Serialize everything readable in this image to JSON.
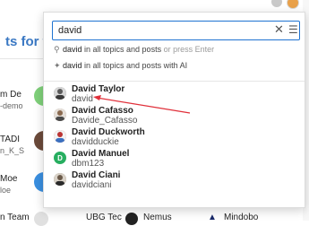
{
  "background": {
    "heading": "ts for te",
    "items": [
      {
        "name": "m De",
        "handle": "-demo"
      },
      {
        "name": "TADI",
        "handle": "n_K_S"
      },
      {
        "name": "Moe",
        "handle": "loe"
      },
      {
        "name": "n Team",
        "handle": ""
      },
      {
        "name": "UBG Tec",
        "handle": ""
      },
      {
        "name": "Nemus",
        "handle": ""
      },
      {
        "name": "Mindobo",
        "handle": ""
      }
    ]
  },
  "search": {
    "value": "david",
    "clear_icon": "✕",
    "options_icon": "☰"
  },
  "suggestions": [
    {
      "icon": "search-icon",
      "term": "david",
      "desc": " in all topics and posts",
      "hint": " or press Enter"
    },
    {
      "icon": "ai-sparkle-icon",
      "term": "david",
      "desc": " in all topics and posts with AI",
      "hint": ""
    }
  ],
  "users": [
    {
      "name": "David Taylor",
      "handle": "david",
      "avatar_color": "#6b6b6b",
      "avatar_letter": ""
    },
    {
      "name": "David Cafasso",
      "handle": "Davide_Cafasso",
      "avatar_color": "#8a7a6a",
      "avatar_letter": ""
    },
    {
      "name": "David Duckworth",
      "handle": "davidduckie",
      "avatar_color": "#c0392b",
      "avatar_letter": ""
    },
    {
      "name": "David Manuel",
      "handle": "dbm123",
      "avatar_color": "#27ae60",
      "avatar_letter": "D"
    },
    {
      "name": "David Ciani",
      "handle": "davidciani",
      "avatar_color": "#7a6b5a",
      "avatar_letter": ""
    }
  ],
  "colors": {
    "accent": "#1f73d1",
    "annotation_arrow": "#e0303a"
  }
}
